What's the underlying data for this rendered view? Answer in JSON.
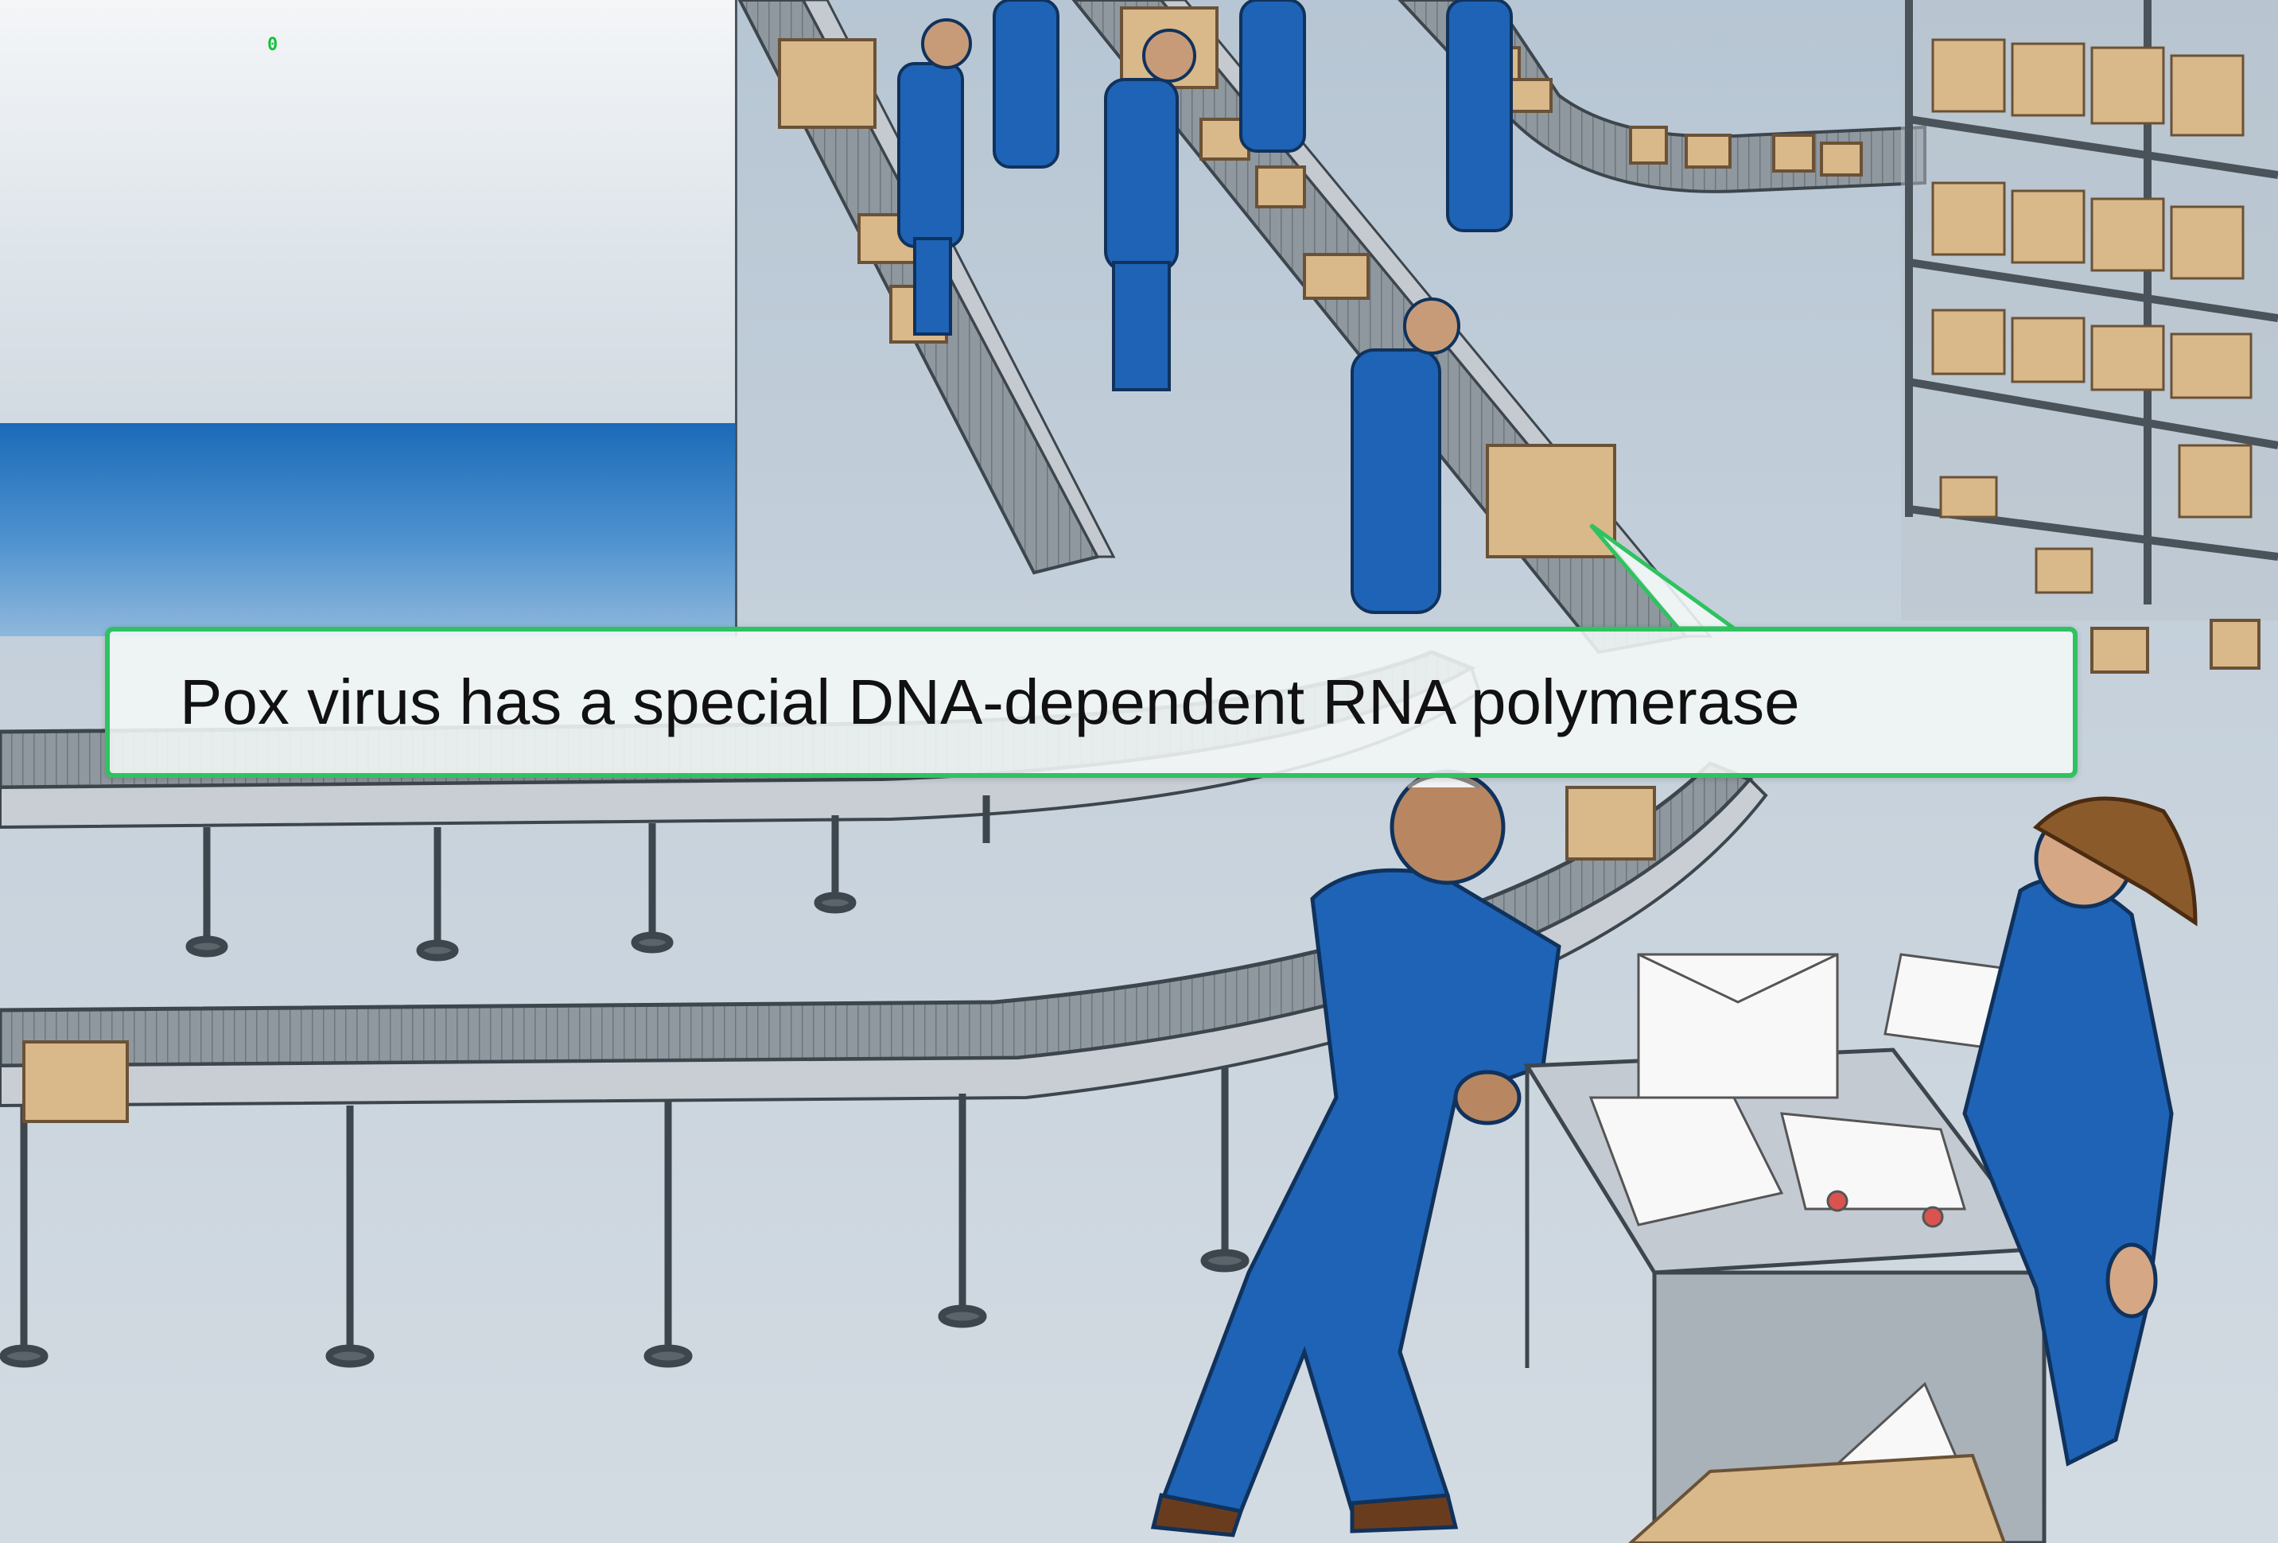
{
  "video": {
    "frame_counter": "0",
    "caption": "Pox virus has a special DNA-dependent RNA polymerase"
  },
  "scene": {
    "floor_color": "#c9d4de",
    "uniform_color": "#1e63b5",
    "box_color": "#d9b88a",
    "conveyor_color": "#a9b0b8",
    "accent_color": "#2fc261"
  }
}
